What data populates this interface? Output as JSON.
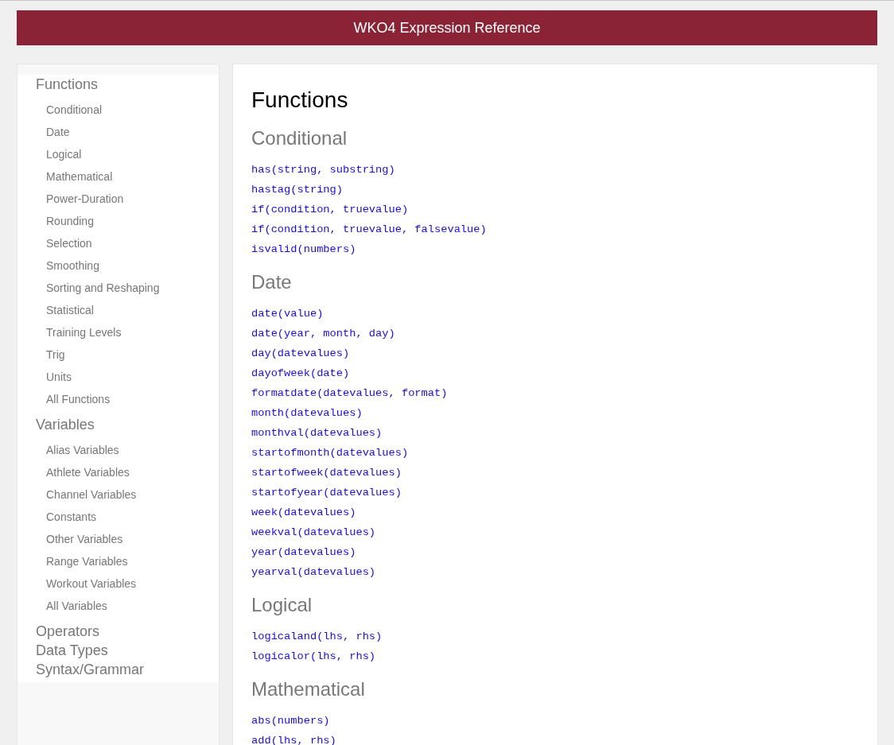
{
  "header": {
    "title": "WKO4 Expression Reference"
  },
  "sidebar": {
    "groups": [
      {
        "label": "Functions",
        "items": [
          "Conditional",
          "Date",
          "Logical",
          "Mathematical",
          "Power-Duration",
          "Rounding",
          "Selection",
          "Smoothing",
          "Sorting and Reshaping",
          "Statistical",
          "Training Levels",
          "Trig",
          "Units",
          "All Functions"
        ]
      },
      {
        "label": "Variables",
        "items": [
          "Alias Variables",
          "Athlete Variables",
          "Channel Variables",
          "Constants",
          "Other Variables",
          "Range Variables",
          "Workout Variables",
          "All Variables"
        ]
      },
      {
        "label": "Operators"
      },
      {
        "label": "Data Types"
      },
      {
        "label": "Syntax/Grammar"
      }
    ]
  },
  "content": {
    "title": "Functions",
    "sections": [
      {
        "heading": "Conditional",
        "entries": [
          "has(string, substring)",
          "hastag(string)",
          "if(condition, truevalue)",
          "if(condition, truevalue, falsevalue)",
          "isvalid(numbers)"
        ]
      },
      {
        "heading": "Date",
        "entries": [
          "date(value)",
          "date(year, month, day)",
          "day(datevalues)",
          "dayofweek(date)",
          "formatdate(datevalues, format)",
          "month(datevalues)",
          "monthval(datevalues)",
          "startofmonth(datevalues)",
          "startofweek(datevalues)",
          "startofyear(datevalues)",
          "week(datevalues)",
          "weekval(datevalues)",
          "year(datevalues)",
          "yearval(datevalues)"
        ]
      },
      {
        "heading": "Logical",
        "entries": [
          "logicaland(lhs, rhs)",
          "logicalor(lhs, rhs)"
        ]
      },
      {
        "heading": "Mathematical",
        "entries": [
          "abs(numbers)",
          "add(lhs, rhs)"
        ]
      }
    ]
  }
}
